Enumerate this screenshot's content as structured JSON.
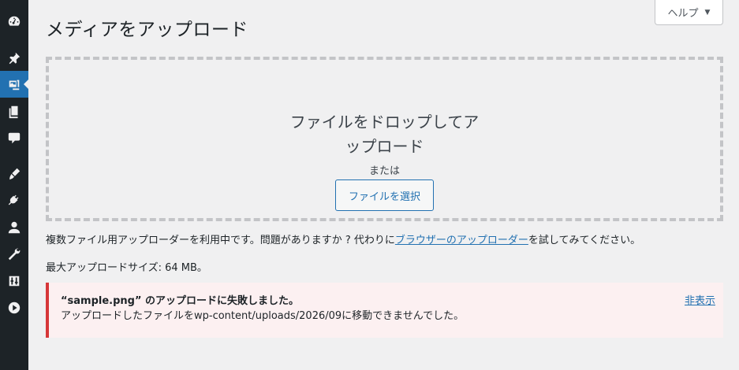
{
  "help": {
    "label": "ヘルプ"
  },
  "page": {
    "title": "メディアをアップロード"
  },
  "upload": {
    "drop_line1": "ファイルをドロップしてア",
    "drop_line2": "ップロード",
    "or_text": "または",
    "select_button": "ファイルを選択"
  },
  "note": {
    "prefix": "複数ファイル用アップローダーを利用中です。問題がありますか ? 代わりに",
    "link": "ブラウザーのアップローダー",
    "suffix": "を試してみてください。"
  },
  "max_size": "最大アップロードサイズ: 64 MB。",
  "error": {
    "title": "“sample.png” のアップロードに失敗しました。",
    "message": "アップロードしたファイルをwp-content/uploads/2026/09に移動できませんでした。",
    "dismiss": "非表示"
  },
  "colors": {
    "sidebar": "#1d2327",
    "accent": "#2271b1",
    "error": "#d63638",
    "error_bg": "#fcf0f1"
  },
  "sidebar_icons": [
    "dashboard-icon",
    "pushpin-icon",
    "media-icon",
    "pages-icon",
    "comments-icon",
    "appearance-icon",
    "plugins-icon",
    "users-icon",
    "tools-icon",
    "settings-icon",
    "play-icon"
  ]
}
